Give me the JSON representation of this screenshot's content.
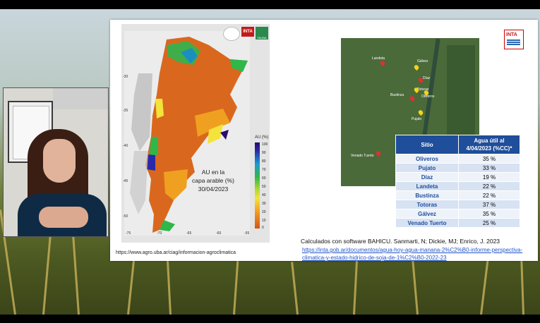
{
  "video": {
    "role": "presenter"
  },
  "map": {
    "caption_line1": "AU en la",
    "caption_line2": "capa arable (%)",
    "caption_date": "30/04/2023",
    "legend_title": "AU (%)",
    "legend_ticks": [
      "100",
      "90",
      "80",
      "70",
      "60",
      "50",
      "40",
      "30",
      "20",
      "10",
      "0"
    ],
    "lat_ticks": [
      "-30",
      "-35",
      "-40",
      "-45",
      "-50"
    ],
    "lon_ticks": [
      "-75",
      "-70",
      "-65",
      "-60",
      "-55"
    ],
    "source_url": "https://www.agro.uba.ar/ciag/informacion-agroclimatica",
    "logos": [
      "INTA",
      "FAUBA"
    ]
  },
  "satellite": {
    "towns": [
      "Landeta",
      "Gálvez",
      "Díaz",
      "Bustinza",
      "Totoras",
      "Oliveros",
      "Pujato",
      "Venado Tuerto"
    ]
  },
  "inta_logo": "INTA",
  "table": {
    "headers": [
      "Sitio",
      "Agua útil al 4/04/2023 (%CC)*"
    ],
    "rows": [
      {
        "site": "Oliveros",
        "value": "35 %"
      },
      {
        "site": "Pujato",
        "value": "33 %"
      },
      {
        "site": "Díaz",
        "value": "19 %"
      },
      {
        "site": "Landeta",
        "value": "22 %"
      },
      {
        "site": "Bustinza",
        "value": "22 %"
      },
      {
        "site": "Totoras",
        "value": "37 %"
      },
      {
        "site": "Gálvez",
        "value": "35 %"
      },
      {
        "site": "Venado Tuerto",
        "value": "25 %"
      }
    ]
  },
  "citation": "Calculados con software BAHICU. Sanmarti, N; Dickie, MJ; Enrico, J. 2023",
  "link": "https://inta.gob.ar/documentos/agua-hoy-agua-manana-2%C2%B0-informe-perspectiva-climatica-y-estado-hidrico-de-soja-de-1%C2%B0-2022-23"
}
